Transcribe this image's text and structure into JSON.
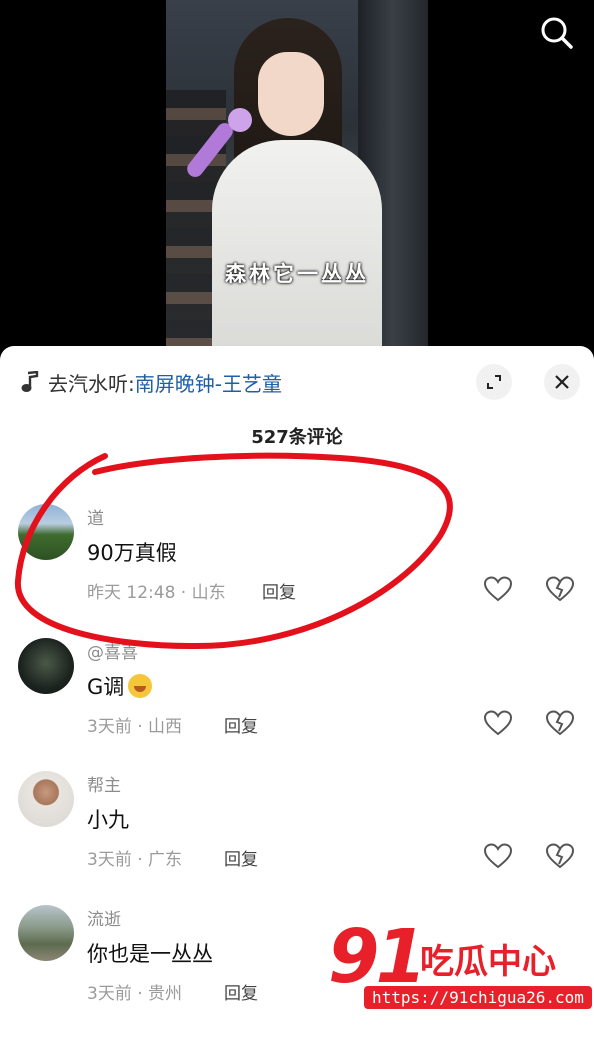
{
  "video": {
    "subtitle": "森林它一丛丛"
  },
  "sheet": {
    "music_prefix": "去汽水听:",
    "music_song": "南屏晚钟-王艺童",
    "comment_count": "527条评论"
  },
  "comments": [
    {
      "name": "道",
      "text": "90万真假",
      "meta": "昨天 12:48 · 山东",
      "reply": "回复"
    },
    {
      "name": "@喜喜",
      "text": "G调",
      "meta": "3天前 · 山西",
      "reply": "回复"
    },
    {
      "name": "帮主",
      "text": "小九",
      "meta": "3天前 · 广东",
      "reply": "回复"
    },
    {
      "name": "流逝",
      "text": "你也是一丛丛",
      "meta": "3天前 · 贵州",
      "reply": "回复"
    }
  ],
  "watermark": {
    "number": "91",
    "brand": "吃瓜中心",
    "url": "https://91chigua26.com"
  },
  "icons": [
    "search-icon",
    "music-note-icon",
    "expand-icon",
    "close-icon",
    "heart-icon",
    "broken-heart-icon",
    "crying-laughing-emoji"
  ],
  "colors": {
    "link": "#1f5fa8",
    "annotation": "#e3111b",
    "watermark": "#e8202a"
  }
}
